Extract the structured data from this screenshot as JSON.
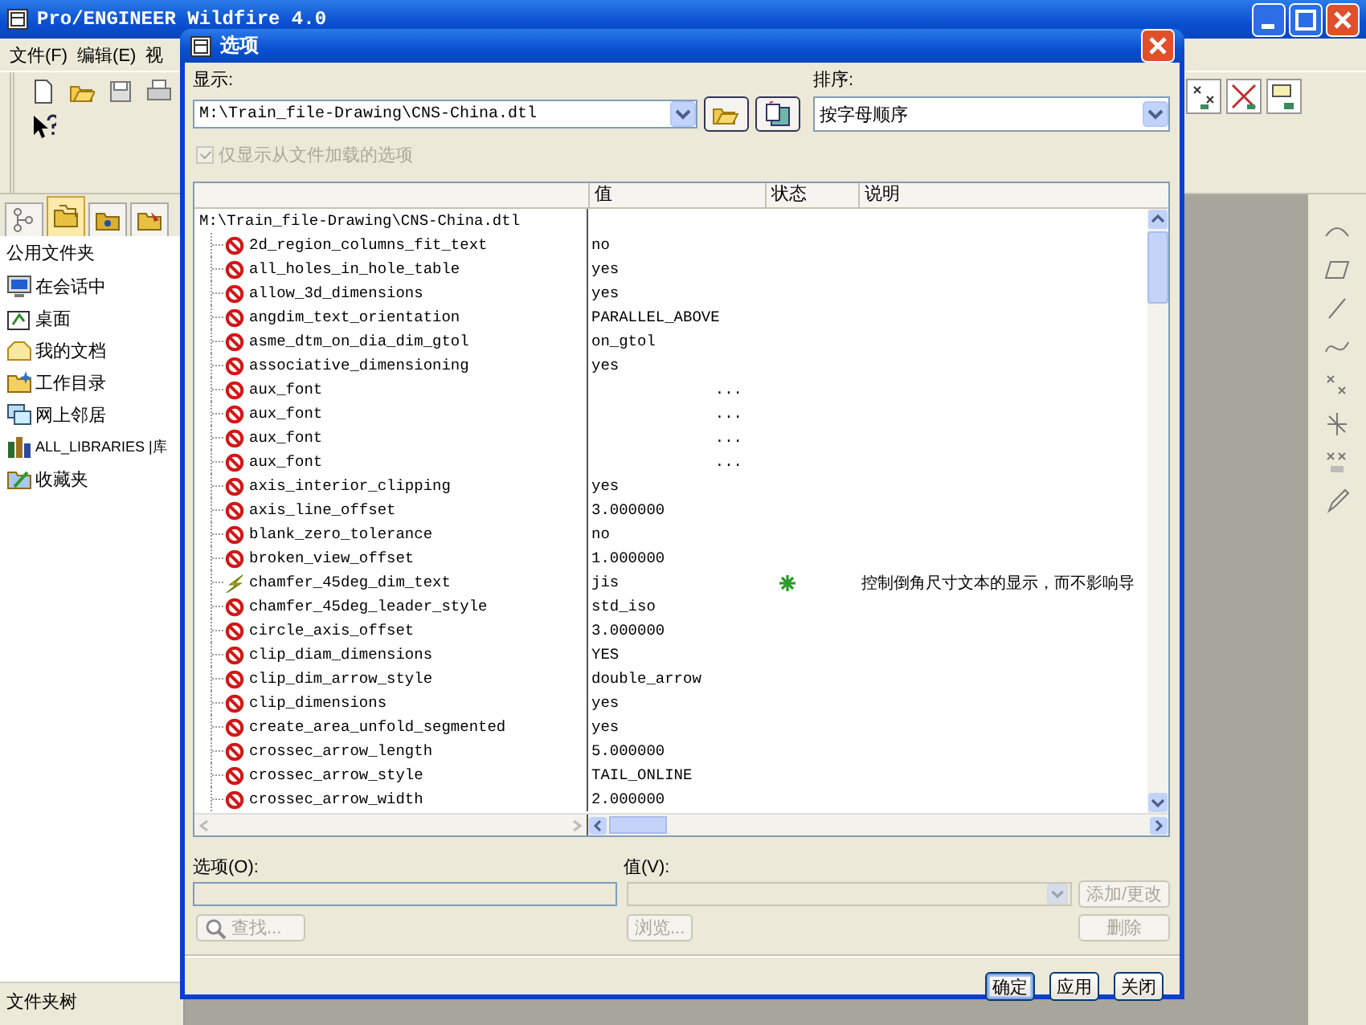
{
  "app": {
    "title": "Pro/ENGINEER Wildfire 4.0",
    "menu": [
      "文件(F)",
      "编辑(E)",
      "视"
    ],
    "sidebar": {
      "tabs": [
        {
          "selected": false
        },
        {
          "selected": true
        },
        {
          "selected": false
        },
        {
          "selected": false
        }
      ],
      "heading": "公用文件夹",
      "items": [
        {
          "label": "在会话中"
        },
        {
          "label": "桌面"
        },
        {
          "label": "我的文档"
        },
        {
          "label": "工作目录"
        },
        {
          "label": "网上邻居"
        },
        {
          "label": "ALL_LIBRARIES |库"
        },
        {
          "label": "收藏夹"
        }
      ],
      "footer": "文件夹树"
    }
  },
  "dialog": {
    "title": "选项",
    "display_label": "显示:",
    "display_value": "M:\\Train_file-Drawing\\CNS-China.dtl",
    "sort_label": "排序:",
    "sort_value": "按字母顺序",
    "filter_checkbox": {
      "label": "仅显示从文件加载的选项",
      "checked": true,
      "disabled": true
    },
    "table": {
      "columns": [
        "值",
        "状态",
        "说明"
      ],
      "tree": {
        "label": "M:\\Train_file-Drawing\\CNS-China.dtl",
        "children": [
          {
            "name": "2d_region_columns_fit_text",
            "kind": "invalid",
            "value": "no",
            "flagged": false
          },
          {
            "name": "all_holes_in_hole_table",
            "kind": "invalid",
            "value": "yes",
            "flagged": false
          },
          {
            "name": "allow_3d_dimensions",
            "kind": "invalid",
            "value": "yes",
            "flagged": false
          },
          {
            "name": "angdim_text_orientation",
            "kind": "invalid",
            "value": "PARALLEL_ABOVE",
            "flagged": false
          },
          {
            "name": "asme_dtm_on_dia_dim_gtol",
            "kind": "invalid",
            "value": "on_gtol",
            "flagged": false
          },
          {
            "name": "associative_dimensioning",
            "kind": "invalid",
            "value": "yes",
            "flagged": false
          },
          {
            "name": "aux_font",
            "kind": "invalid",
            "browse": "...",
            "flagged": false
          },
          {
            "name": "aux_font",
            "kind": "invalid",
            "browse": "...",
            "flagged": false
          },
          {
            "name": "aux_font",
            "kind": "invalid",
            "browse": "...",
            "flagged": false
          },
          {
            "name": "aux_font",
            "kind": "invalid",
            "browse": "...",
            "flagged": false
          },
          {
            "name": "axis_interior_clipping",
            "kind": "invalid",
            "value": "yes",
            "flagged": false
          },
          {
            "name": "axis_line_offset",
            "kind": "invalid",
            "value": "3.000000",
            "flagged": false
          },
          {
            "name": "blank_zero_tolerance",
            "kind": "invalid",
            "value": "no",
            "flagged": false
          },
          {
            "name": "broken_view_offset",
            "kind": "invalid",
            "value": "1.000000",
            "flagged": false
          },
          {
            "name": "chamfer_45deg_dim_text",
            "kind": "modified",
            "value": "jis",
            "flagged": true,
            "description": "控制倒角尺寸文本的显示，而不影响导"
          },
          {
            "name": "chamfer_45deg_leader_style",
            "kind": "invalid",
            "value": "std_iso",
            "flagged": false
          },
          {
            "name": "circle_axis_offset",
            "kind": "invalid",
            "value": "3.000000",
            "flagged": false
          },
          {
            "name": "clip_diam_dimensions",
            "kind": "invalid",
            "value": "YES",
            "flagged": false
          },
          {
            "name": "clip_dim_arrow_style",
            "kind": "invalid",
            "value": "double_arrow",
            "flagged": false
          },
          {
            "name": "clip_dimensions",
            "kind": "invalid",
            "value": "yes",
            "flagged": false
          },
          {
            "name": "create_area_unfold_segmented",
            "kind": "invalid",
            "value": "yes",
            "flagged": false
          },
          {
            "name": "crossec_arrow_length",
            "kind": "invalid",
            "value": "5.000000",
            "flagged": false
          },
          {
            "name": "crossec_arrow_style",
            "kind": "invalid",
            "value": "TAIL_ONLINE",
            "flagged": false
          },
          {
            "name": "crossec_arrow_width",
            "kind": "invalid",
            "value": "2.000000",
            "flagged": false
          }
        ]
      }
    },
    "option_label": "选项(O):",
    "value_label": "值(V):",
    "add_button": {
      "label": "添加/更改",
      "disabled": true
    },
    "find_button": {
      "label": "查找...",
      "disabled": true
    },
    "browse_button": {
      "label": "浏览...",
      "disabled": true
    },
    "delete_button": {
      "label": "删除",
      "disabled": true
    },
    "footer_buttons": [
      {
        "label": "确定",
        "default": true
      },
      {
        "label": "应用",
        "default": false
      },
      {
        "label": "关闭",
        "default": false
      }
    ]
  }
}
